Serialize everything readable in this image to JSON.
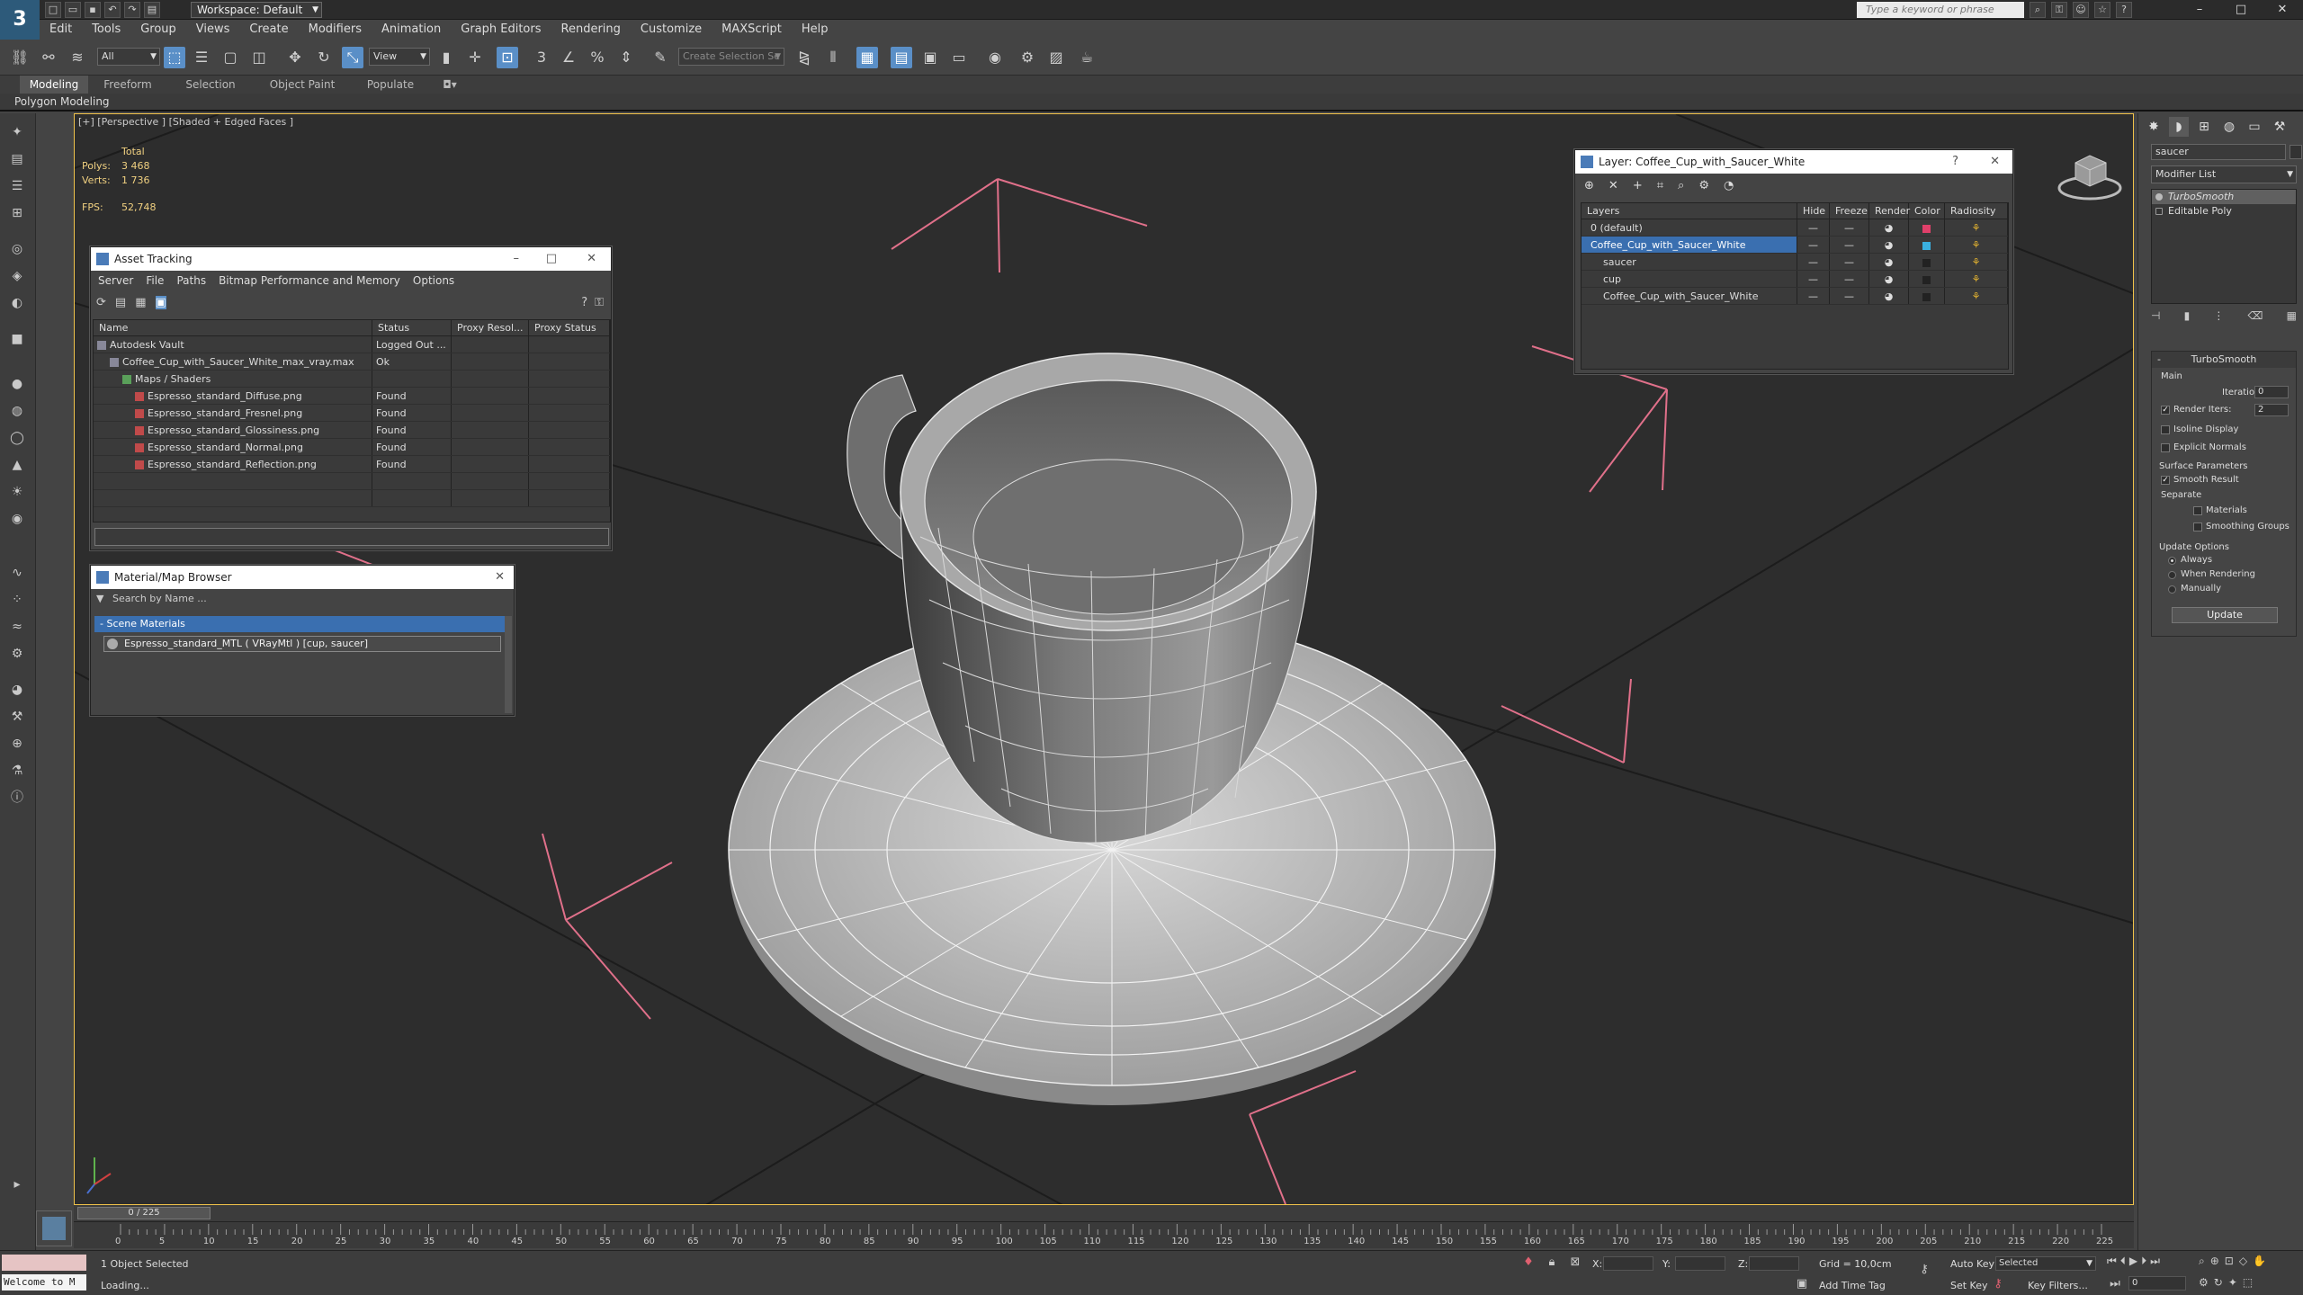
{
  "app": {
    "logo": "3",
    "workspace": "Workspace: Default",
    "search_placeholder": "Type a keyword or phrase",
    "window_controls": [
      "–",
      "□",
      "✕"
    ]
  },
  "menu": [
    "Edit",
    "Tools",
    "Group",
    "Views",
    "Create",
    "Modifiers",
    "Animation",
    "Graph Editors",
    "Rendering",
    "Customize",
    "MAXScript",
    "Help"
  ],
  "toolbar": {
    "filter_value": "All",
    "refcoord_value": "View",
    "selection_set_placeholder": "Create Selection Se"
  },
  "ribbon": {
    "tabs": [
      "Modeling",
      "Freeform",
      "Selection",
      "Object Paint",
      "Populate"
    ],
    "panel_label": "Polygon Modeling"
  },
  "viewport": {
    "label": "[+] [Perspective ] [Shaded + Edged Faces ]",
    "stats_header": "Total",
    "polys_label": "Polys:",
    "polys_value": "3 468",
    "verts_label": "Verts:",
    "verts_value": "1 736",
    "fps_label": "FPS:",
    "fps_value": "52,748"
  },
  "asset_tracking": {
    "title": "Asset Tracking",
    "menu": [
      "Server",
      "File",
      "Paths",
      "Bitmap Performance and Memory",
      "Options"
    ],
    "columns": [
      "Name",
      "Status",
      "Proxy Resol...",
      "Proxy Status"
    ],
    "rows": [
      {
        "name": "Autodesk Vault",
        "status": "Logged Out ...",
        "indent": 0
      },
      {
        "name": "Coffee_Cup_with_Saucer_White_max_vray.max",
        "status": "Ok",
        "indent": 1
      },
      {
        "name": "Maps / Shaders",
        "status": "",
        "indent": 2
      },
      {
        "name": "Espresso_standard_Diffuse.png",
        "status": "Found",
        "indent": 3
      },
      {
        "name": "Espresso_standard_Fresnel.png",
        "status": "Found",
        "indent": 3
      },
      {
        "name": "Espresso_standard_Glossiness.png",
        "status": "Found",
        "indent": 3
      },
      {
        "name": "Espresso_standard_Normal.png",
        "status": "Found",
        "indent": 3
      },
      {
        "name": "Espresso_standard_Reflection.png",
        "status": "Found",
        "indent": 3
      }
    ]
  },
  "material_browser": {
    "title": "Material/Map Browser",
    "search_placeholder": "Search by Name ...",
    "group": "- Scene Materials",
    "item": "Espresso_standard_MTL ( VRayMtl ) [cup, saucer]"
  },
  "layer_explorer": {
    "title": "Layer: Coffee_Cup_with_Saucer_White",
    "columns": [
      "Layers",
      "Hide",
      "Freeze",
      "Render",
      "Color",
      "Radiosity"
    ],
    "rows": [
      {
        "name": "0 (default)",
        "indent": 0,
        "color": "#e0406a"
      },
      {
        "name": "Coffee_Cup_with_Saucer_White",
        "indent": 0,
        "color": "#3ab0e0"
      },
      {
        "name": "saucer",
        "indent": 1,
        "color": "#222222"
      },
      {
        "name": "cup",
        "indent": 1,
        "color": "#222222"
      },
      {
        "name": "Coffee_Cup_with_Saucer_White",
        "indent": 1,
        "color": "#222222"
      }
    ]
  },
  "command_panel": {
    "object_name": "saucer",
    "modifier_list": "Modifier List",
    "stack": [
      "TurboSmooth",
      "Editable Poly"
    ],
    "turbosmooth": {
      "title": "TurboSmooth",
      "main": "Main",
      "iterations_label": "Iterations:",
      "iterations_value": "0",
      "render_iters_label": "Render Iters:",
      "render_iters_value": "2",
      "isoline": "Isoline Display",
      "explicit": "Explicit Normals",
      "surface_params": "Surface Parameters",
      "smooth_result": "Smooth Result",
      "separate": "Separate",
      "materials": "Materials",
      "smoothing_groups": "Smoothing Groups",
      "update_options": "Update Options",
      "always": "Always",
      "when_rendering": "When Rendering",
      "manually": "Manually",
      "update_button": "Update"
    }
  },
  "timeline": {
    "slider": "0 / 225",
    "ticks": [
      "0",
      "5",
      "10",
      "15",
      "20",
      "25",
      "30",
      "35",
      "40",
      "45",
      "50",
      "55",
      "60",
      "65",
      "70",
      "75",
      "80",
      "85",
      "90",
      "95",
      "100",
      "105",
      "110",
      "115",
      "120",
      "125",
      "130",
      "135",
      "140",
      "145",
      "150",
      "155",
      "160",
      "165",
      "170",
      "175",
      "180",
      "185",
      "190",
      "195",
      "200",
      "205",
      "210",
      "215",
      "220",
      "225"
    ]
  },
  "status": {
    "maxscript_listener": "Welcome to M",
    "selected": "1 Object Selected",
    "prompt": "Loading...",
    "x_label": "X:",
    "y_label": "Y:",
    "z_label": "Z:",
    "grid": "Grid = 10,0cm",
    "add_time_tag": "Add Time Tag",
    "auto_key": "Auto Key",
    "set_key": "Set Key",
    "selected_dd": "Selected",
    "key_filters": "Key Filters...",
    "frame": "0"
  }
}
